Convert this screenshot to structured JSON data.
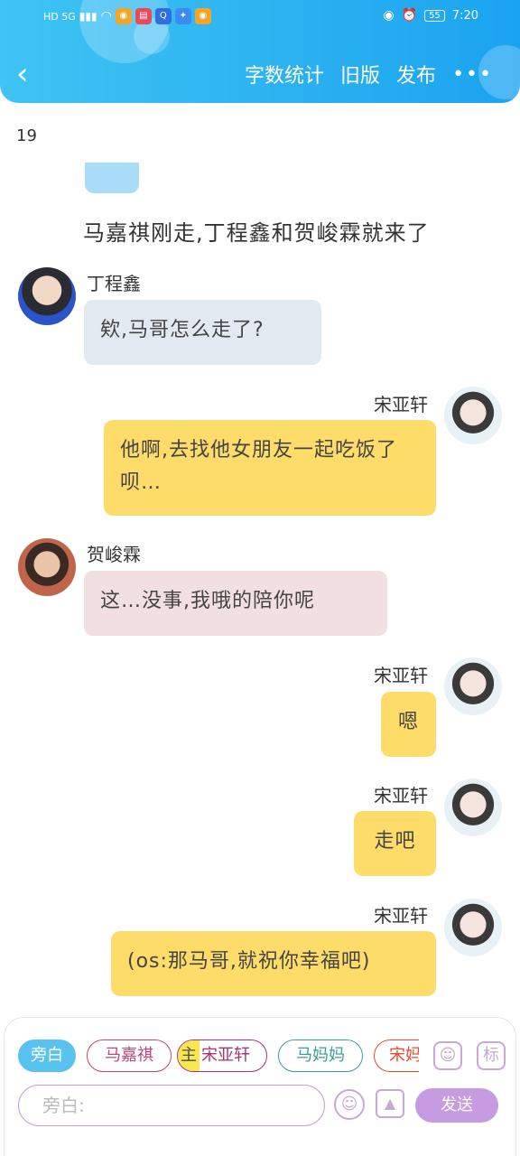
{
  "status_bar": {
    "left_label": "HD 5G",
    "battery": "55",
    "time": "7:20"
  },
  "header": {
    "back_icon": "chevron-left-icon",
    "actions": [
      "字数统计",
      "旧版",
      "发布"
    ],
    "more_icon": "more-horizontal-icon"
  },
  "chat": {
    "counter": "19",
    "narration": "马嘉祺刚走,丁程鑫和贺峻霖就来了",
    "messages": [
      {
        "speaker": "丁程鑫",
        "side": "left",
        "text": "欸,马哥怎么走了?"
      },
      {
        "speaker": "宋亚轩",
        "side": "right",
        "text": "他啊,去找他女朋友一起吃饭了呗…"
      },
      {
        "speaker": "贺峻霖",
        "side": "left",
        "text": "这…没事,我哦的陪你呢"
      },
      {
        "speaker": "宋亚轩",
        "side": "right",
        "text": "嗯"
      },
      {
        "speaker": "宋亚轩",
        "side": "right",
        "text": "走吧"
      },
      {
        "speaker": "宋亚轩",
        "side": "right",
        "text": "(os:那马哥,就祝你幸福吧)"
      }
    ]
  },
  "composer": {
    "chips": [
      "旁白",
      "马嘉祺",
      "宋亚轩",
      "马妈妈",
      "宋妈"
    ],
    "main_tag": "主",
    "placeholder": "旁白:",
    "send_label": "发送",
    "side_icons": [
      "person-icon",
      "tag-icon"
    ],
    "tag_icon_label": "标"
  },
  "colors": {
    "header": "#2ab0f0",
    "yellow_bubble": "#fedc6a",
    "blue_bubble": "#e2e9f1",
    "pink_bubble": "#f2dfe1",
    "send_button": "#c79be0"
  }
}
